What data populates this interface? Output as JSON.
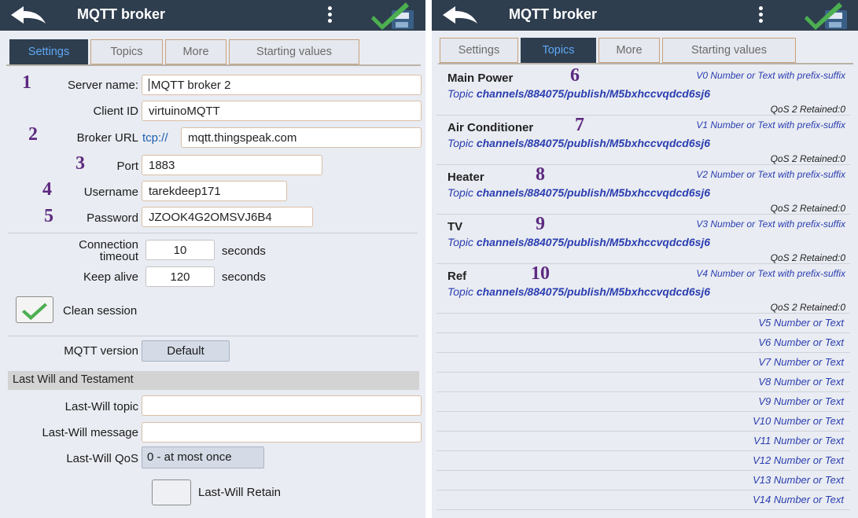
{
  "left_panel": {
    "title": "MQTT broker",
    "tabs": [
      "Settings",
      "Topics",
      "More",
      "Starting values"
    ],
    "active_tab": "Settings",
    "annotations": [
      "1",
      "2",
      "3",
      "4",
      "5"
    ],
    "fields": {
      "server_name": {
        "label": "Server name:",
        "value": "MQTT broker 2"
      },
      "client_id": {
        "label": "Client ID",
        "value": "virtuinoMQTT"
      },
      "broker_url": {
        "label": "Broker URL",
        "prefix": "tcp://",
        "value": "mqtt.thingspeak.com"
      },
      "port": {
        "label": "Port",
        "value": "1883"
      },
      "username": {
        "label": "Username",
        "value": "tarekdeep171"
      },
      "password": {
        "label": "Password",
        "value": "JZOOK4G2OMSVJ6B4"
      }
    },
    "connection_timeout": {
      "label_line1": "Connection",
      "label_line2": "timeout",
      "value": "10",
      "unit": "seconds"
    },
    "keep_alive": {
      "label": "Keep alive",
      "value": "120",
      "unit": "seconds"
    },
    "clean_session": {
      "label": "Clean session",
      "checked": true
    },
    "mqtt_version": {
      "label": "MQTT version",
      "value": "Default"
    },
    "last_will": {
      "header": "Last Will and Testament",
      "topic_label": "Last-Will topic",
      "topic_value": "",
      "message_label": "Last-Will message",
      "message_value": "",
      "qos_label": "Last-Will QoS",
      "qos_value": "0 - at most once",
      "retain_label": "Last-Will Retain",
      "retain_checked": false
    }
  },
  "right_panel": {
    "title": "MQTT broker",
    "tabs": [
      "Settings",
      "Topics",
      "More",
      "Starting values"
    ],
    "active_tab": "Topics",
    "topics": [
      {
        "name": "Main Power",
        "annotation": "6",
        "var": "V0  Number or Text with prefix-suffix",
        "topic_word": "Topic",
        "path": "channels/884075/publish/M5bxhccvqdcd6sj6",
        "qos": "QoS 2  Retained:0"
      },
      {
        "name": "Air Conditioner",
        "annotation": "7",
        "var": "V1  Number or Text with prefix-suffix",
        "topic_word": "Topic",
        "path": "channels/884075/publish/M5bxhccvqdcd6sj6",
        "qos": "QoS 2  Retained:0"
      },
      {
        "name": "Heater",
        "annotation": "8",
        "var": "V2  Number or Text with prefix-suffix",
        "topic_word": "Topic",
        "path": "channels/884075/publish/M5bxhccvqdcd6sj6",
        "qos": "QoS 2  Retained:0"
      },
      {
        "name": "TV",
        "annotation": "9",
        "var": "V3  Number or Text with prefix-suffix",
        "topic_word": "Topic",
        "path": "channels/884075/publish/M5bxhccvqdcd6sj6",
        "qos": "QoS 2  Retained:0"
      },
      {
        "name": "Ref",
        "annotation": "10",
        "var": "V4  Number or Text with prefix-suffix",
        "topic_word": "Topic",
        "path": "channels/884075/publish/M5bxhccvqdcd6sj6",
        "qos": "QoS 2  Retained:0"
      }
    ],
    "empty_slots": [
      "V5  Number or Text",
      "V6  Number or Text",
      "V7  Number or Text",
      "V8  Number or Text",
      "V9  Number or Text",
      "V10  Number or Text",
      "V11  Number or Text",
      "V12  Number or Text",
      "V13  Number or Text",
      "V14  Number or Text"
    ]
  },
  "icons": {
    "back": "back-arrow-icon",
    "menu": "overflow-menu-icon",
    "save": "save-check-icon"
  },
  "colors": {
    "appbar": "#2e3e4f",
    "active_tab_text": "#5fa8f5",
    "annotation": "#5d2a80",
    "link_blue": "#2a3db0",
    "check_green": "#4caf50"
  }
}
